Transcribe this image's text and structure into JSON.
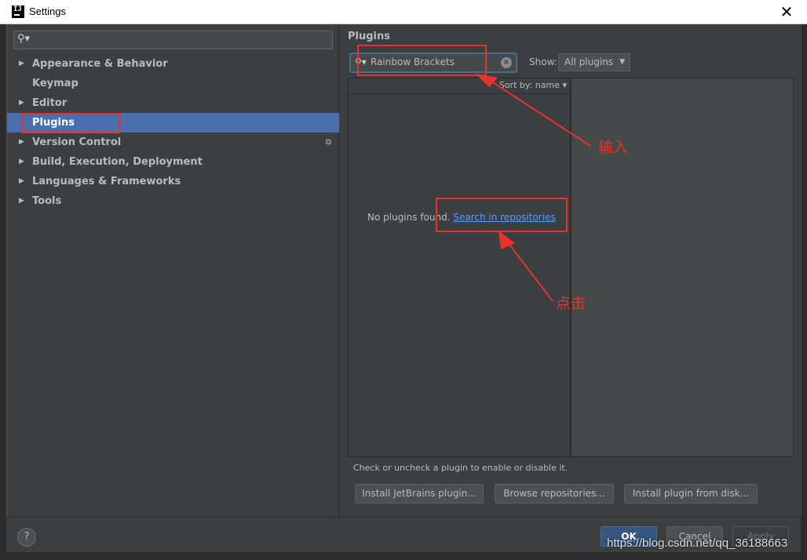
{
  "window": {
    "title": "Settings",
    "close_glyph": "✕"
  },
  "sidebar": {
    "search": {
      "icon": "search-icon",
      "value": ""
    },
    "items": [
      {
        "label": "Appearance & Behavior",
        "expandable": true
      },
      {
        "label": "Keymap",
        "expandable": false
      },
      {
        "label": "Editor",
        "expandable": true
      },
      {
        "label": "Plugins",
        "expandable": false,
        "selected": true
      },
      {
        "label": "Version Control",
        "expandable": true
      },
      {
        "label": "Build, Execution, Deployment",
        "expandable": true
      },
      {
        "label": "Languages & Frameworks",
        "expandable": true
      },
      {
        "label": "Tools",
        "expandable": true
      }
    ]
  },
  "plugins": {
    "title": "Plugins",
    "search_value": "Rainbow Brackets",
    "show_label": "Show:",
    "show_value": "All plugins",
    "sort_label": "Sort by: name",
    "empty_text": "No plugins found.",
    "empty_link": "Search in repositories",
    "hint": "Check or uncheck a plugin to enable or disable it.",
    "buttons": {
      "install_jetbrains": "Install JetBrains plugin...",
      "browse_repos": "Browse repositories...",
      "install_disk": "Install plugin from disk..."
    }
  },
  "footer": {
    "help": "?",
    "ok": "OK",
    "cancel": "Cancel",
    "apply": "Apply"
  },
  "annotations": {
    "input_label": "输入",
    "click_label": "点击",
    "color": "#e8322a"
  },
  "watermark": "https://blog.csdn.net/qq_36188663",
  "colors": {
    "selection": "#4b6eaf",
    "link": "#589df6",
    "panel": "#3c3f41"
  }
}
